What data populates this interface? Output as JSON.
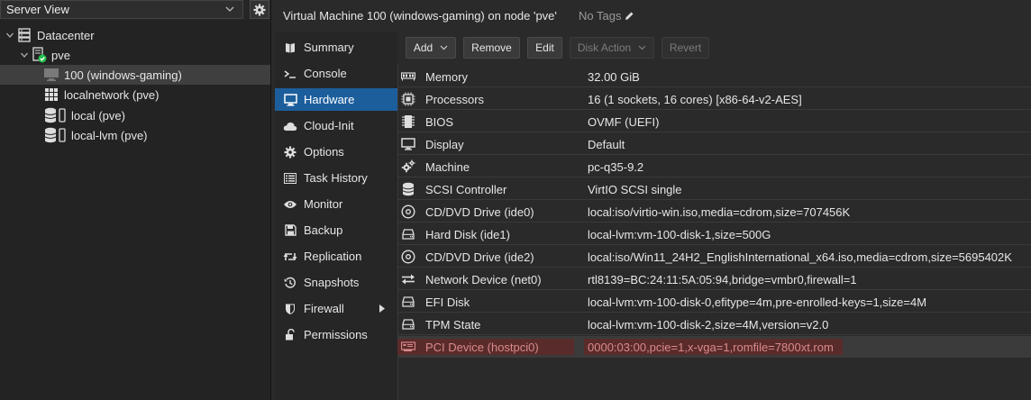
{
  "left_panel": {
    "view_select": "Server View",
    "tree": [
      {
        "label": "Datacenter",
        "icon": "datacenter-icon"
      },
      {
        "label": "pve",
        "icon": "node-online-icon"
      },
      {
        "label": "100 (windows-gaming)",
        "icon": "vm-icon",
        "selected": true
      },
      {
        "label": "localnetwork (pve)",
        "icon": "sdn-grid-icon"
      },
      {
        "label": "local (pve)",
        "icon": "storage-icon"
      },
      {
        "label": "local-lvm (pve)",
        "icon": "storage-icon"
      }
    ]
  },
  "header": {
    "title": "Virtual Machine 100 (windows-gaming) on node 'pve'",
    "tags": "No Tags"
  },
  "nav": {
    "items": [
      {
        "label": "Summary",
        "icon": "book-icon"
      },
      {
        "label": "Console",
        "icon": "terminal-icon"
      },
      {
        "label": "Hardware",
        "icon": "desktop-icon",
        "active": true
      },
      {
        "label": "Cloud-Init",
        "icon": "cloud-icon"
      },
      {
        "label": "Options",
        "icon": "gear-icon"
      },
      {
        "label": "Task History",
        "icon": "list-icon"
      },
      {
        "label": "Monitor",
        "icon": "eye-icon"
      },
      {
        "label": "Backup",
        "icon": "floppy-icon"
      },
      {
        "label": "Replication",
        "icon": "retweet-icon"
      },
      {
        "label": "Snapshots",
        "icon": "history-icon"
      },
      {
        "label": "Firewall",
        "icon": "shield-icon",
        "submenu": true
      },
      {
        "label": "Permissions",
        "icon": "unlock-icon"
      }
    ]
  },
  "toolbar": {
    "add": "Add",
    "remove": "Remove",
    "edit": "Edit",
    "disk_action": "Disk Action",
    "revert": "Revert"
  },
  "hardware": [
    {
      "name": "Memory",
      "value": "32.00 GiB",
      "icon": "memory-icon"
    },
    {
      "name": "Processors",
      "value": "16 (1 sockets, 16 cores) [x86-64-v2-AES]",
      "icon": "cpu-icon"
    },
    {
      "name": "BIOS",
      "value": "OVMF (UEFI)",
      "icon": "microchip-icon"
    },
    {
      "name": "Display",
      "value": "Default",
      "icon": "monitor-icon"
    },
    {
      "name": "Machine",
      "value": "pc-q35-9.2",
      "icon": "cogs-icon"
    },
    {
      "name": "SCSI Controller",
      "value": "VirtIO SCSI single",
      "icon": "database-icon"
    },
    {
      "name": "CD/DVD Drive (ide0)",
      "value": "local:iso/virtio-win.iso,media=cdrom,size=707456K",
      "icon": "cdrom-icon"
    },
    {
      "name": "Hard Disk (ide1)",
      "value": "local-lvm:vm-100-disk-1,size=500G",
      "icon": "hdd-icon"
    },
    {
      "name": "CD/DVD Drive (ide2)",
      "value": "local:iso/Win11_24H2_EnglishInternational_x64.iso,media=cdrom,size=5695402K",
      "icon": "cdrom-icon"
    },
    {
      "name": "Network Device (net0)",
      "value": "rtl8139=BC:24:11:5A:05:94,bridge=vmbr0,firewall=1",
      "icon": "exchange-icon"
    },
    {
      "name": "EFI Disk",
      "value": "local-lvm:vm-100-disk-0,efitype=4m,pre-enrolled-keys=1,size=4M",
      "icon": "hdd-icon"
    },
    {
      "name": "TPM State",
      "value": "local-lvm:vm-100-disk-2,size=4M,version=v2.0",
      "icon": "hdd-icon"
    },
    {
      "name": "PCI Device (hostpci0)",
      "value": "0000:03:00,pcie=1,x-vga=1,romfile=7800xt.rom",
      "icon": "pci-card-icon",
      "pending": true
    }
  ],
  "colors": {
    "active_nav": "#1c5e9c",
    "pending_text": "#d98a8a",
    "pending_highlight": "#5a2b2b",
    "node_online": "#21bf4b"
  }
}
